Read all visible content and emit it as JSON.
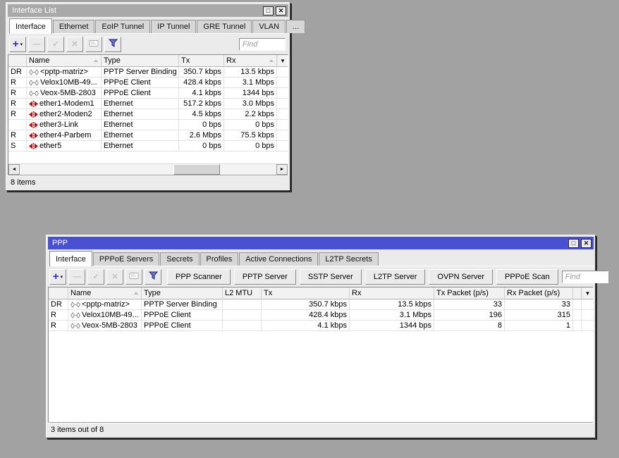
{
  "colors": {
    "desktop_bg": "#a2a2a2",
    "active_titlebar": "#4a50d2",
    "inactive_titlebar": "#a9a9a9",
    "window_bg": "#ebebeb",
    "ethernet_icon": "#b41414",
    "ppp_icon": "#8a8a8a",
    "add_icon_blue": "#2626cc"
  },
  "shared_icons": {
    "add": "+",
    "dropdown_caret": "▾",
    "remove": "—",
    "enable": "✓",
    "disable": "✕",
    "column_menu": "▼",
    "scroll_left": "◄",
    "scroll_right": "►",
    "maximize": "□",
    "close": "✕"
  },
  "interface_list": {
    "title": "Interface List",
    "active_tab": "Interface",
    "tabs": [
      "Interface",
      "Ethernet",
      "EoIP Tunnel",
      "IP Tunnel",
      "GRE Tunnel",
      "VLAN",
      "..."
    ],
    "find_placeholder": "Find",
    "columns": [
      "Name",
      "Type",
      "Tx",
      "Rx"
    ],
    "rows": [
      {
        "flags": "DR",
        "icon": "ppp-interface-icon",
        "name": "<pptp-matriz>",
        "type": "PPTP Server Binding",
        "tx": "350.7 kbps",
        "rx": "13.5 kbps"
      },
      {
        "flags": "R",
        "icon": "ppp-interface-icon",
        "name": "Velox10MB-49...",
        "type": "PPPoE Client",
        "tx": "428.4 kbps",
        "rx": "3.1 Mbps"
      },
      {
        "flags": "R",
        "icon": "ppp-interface-icon",
        "name": "Veox-5MB-2803",
        "type": "PPPoE Client",
        "tx": "4.1 kbps",
        "rx": "1344 bps"
      },
      {
        "flags": "R",
        "icon": "ethernet-interface-icon",
        "name": "ether1-Modem1",
        "type": "Ethernet",
        "tx": "517.2 kbps",
        "rx": "3.0 Mbps"
      },
      {
        "flags": "R",
        "icon": "ethernet-interface-icon",
        "name": "ether2-Moden2",
        "type": "Ethernet",
        "tx": "4.5 kbps",
        "rx": "2.2 kbps"
      },
      {
        "flags": "",
        "icon": "ethernet-interface-icon",
        "name": "ether3-Link",
        "type": "Ethernet",
        "tx": "0 bps",
        "rx": "0 bps"
      },
      {
        "flags": "R",
        "icon": "ethernet-interface-icon",
        "name": "ether4-Parbem",
        "type": "Ethernet",
        "tx": "2.6 Mbps",
        "rx": "75.5 kbps"
      },
      {
        "flags": "S",
        "icon": "ethernet-interface-icon",
        "name": "ether5",
        "type": "Ethernet",
        "tx": "0 bps",
        "rx": "0 bps"
      }
    ],
    "status": "8 items"
  },
  "ppp": {
    "title": "PPP",
    "active_tab": "Interface",
    "tabs": [
      "Interface",
      "PPPoE Servers",
      "Secrets",
      "Profiles",
      "Active Connections",
      "L2TP Secrets"
    ],
    "action_buttons": [
      "PPP Scanner",
      "PPTP Server",
      "SSTP Server",
      "L2TP Server",
      "OVPN Server",
      "PPPoE Scan"
    ],
    "find_placeholder": "Find",
    "columns": [
      "Name",
      "Type",
      "L2 MTU",
      "Tx",
      "Rx",
      "Tx Packet (p/s)",
      "Rx Packet (p/s)"
    ],
    "rows": [
      {
        "flags": "DR",
        "icon": "ppp-interface-icon",
        "name": "<pptp-matriz>",
        "type": "PPTP Server Binding",
        "l2mtu": "",
        "tx": "350.7 kbps",
        "rx": "13.5 kbps",
        "tx_packet": "33",
        "rx_packet": "33"
      },
      {
        "flags": "R",
        "icon": "ppp-interface-icon",
        "name": "Velox10MB-49...",
        "type": "PPPoE Client",
        "l2mtu": "",
        "tx": "428.4 kbps",
        "rx": "3.1 Mbps",
        "tx_packet": "196",
        "rx_packet": "315"
      },
      {
        "flags": "R",
        "icon": "ppp-interface-icon",
        "name": "Veox-5MB-2803",
        "type": "PPPoE Client",
        "l2mtu": "",
        "tx": "4.1 kbps",
        "rx": "1344 bps",
        "tx_packet": "8",
        "rx_packet": "1"
      }
    ],
    "status": "3 items out of 8"
  }
}
